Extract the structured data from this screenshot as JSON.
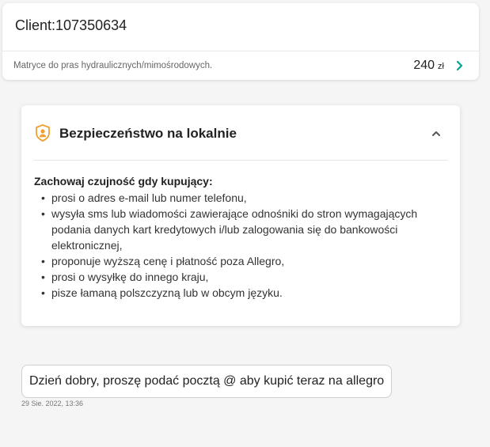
{
  "header": {
    "client_label": "Client:107350634"
  },
  "offer": {
    "title": "Matryce do pras hydraulicznych/mimośrodowych.",
    "price": "240",
    "currency": "zł",
    "chevron_icon": "chevron-right-icon",
    "accent_color": "#00a790"
  },
  "security": {
    "icon": "shield-user-icon",
    "icon_color": "#f0a030",
    "title": "Bezpieczeństwo na lokalnie",
    "collapse_icon": "chevron-up-icon",
    "heading": "Zachowaj czujność gdy kupujący:",
    "bullet": "•",
    "items": [
      "prosi o adres e-mail lub numer telefonu,",
      "wysyła sms lub wiadomości zawierające odnośniki do stron wymagających podania danych kart kredytowych i/lub zalogowania się do bankowości elektronicznej,",
      "proponuje wyższą cenę i płatność poza Allegro,",
      "prosi o wysyłkę do innego kraju,",
      "pisze łamaną polszczyzną lub w obcym języku."
    ]
  },
  "message": {
    "text": "Dzień dobry, proszę podać pocztą @ aby kupić teraz na allegro",
    "timestamp": "29 Sie. 2022, 13:36"
  }
}
